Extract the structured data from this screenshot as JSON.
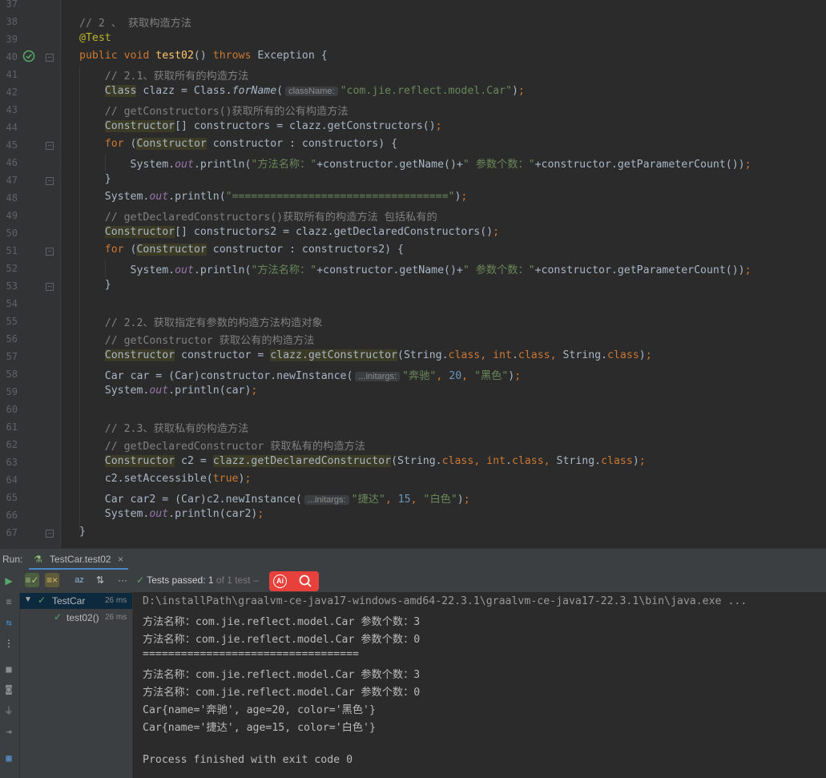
{
  "editor": {
    "lines": [
      {
        "n": "37",
        "html": ""
      },
      {
        "n": "38",
        "html": "<span class='cm'>// 2 、 获取构造方法</span>"
      },
      {
        "n": "39",
        "html": "<span class='an'>@Test</span>"
      },
      {
        "n": "40",
        "html": "<span class='kw'>public void </span><span class='fn'>test02</span>() <span class='kw'>throws </span>Exception {"
      },
      {
        "n": "41",
        "html": "    <span class='cm'>// 2.1、获取所有的构造方法</span>"
      },
      {
        "n": "42",
        "html": "    <span class='hl'>Class</span> clazz = Class.<span class='itf'>forName</span>(<span class='hint'>className:</span><span class='st'>\"com.jie.reflect.model.Car\"</span>)<span class='kw'>;</span>"
      },
      {
        "n": "43",
        "html": "    <span class='cm'>// getConstructors()获取所有的公有构造方法</span>"
      },
      {
        "n": "44",
        "html": "    <span class='hl'>Constructor</span>[] constructors = clazz.getConstructors()<span class='kw'>;</span>"
      },
      {
        "n": "45",
        "html": "    <span class='kw'>for </span>(<span class='hl'>Constructor</span> constructor : constructors) {"
      },
      {
        "n": "46",
        "html": "        System.<span class='it'>out</span>.println(<span class='st'>\"方法名称：\"</span>+constructor.getName()+<span class='st'>\" 参数个数：\"</span>+constructor.getParameterCount())<span class='kw'>;</span>"
      },
      {
        "n": "47",
        "html": "    }"
      },
      {
        "n": "48",
        "html": "    System.<span class='it'>out</span>.println(<span class='st'>\"==================================\"</span>)<span class='kw'>;</span>"
      },
      {
        "n": "49",
        "html": "    <span class='cm'>// getDeclaredConstructors()获取所有的构造方法 包括私有的</span>"
      },
      {
        "n": "50",
        "html": "    <span class='hl'>Constructor</span>[] constructors2 = clazz.getDeclaredConstructors()<span class='kw'>;</span>"
      },
      {
        "n": "51",
        "html": "    <span class='kw'>for </span>(<span class='hl'>Constructor</span> constructor : constructors2) {"
      },
      {
        "n": "52",
        "html": "        System.<span class='it'>out</span>.println(<span class='st'>\"方法名称：\"</span>+constructor.getName()+<span class='st'>\" 参数个数：\"</span>+constructor.getParameterCount())<span class='kw'>;</span>"
      },
      {
        "n": "53",
        "html": "    }"
      },
      {
        "n": "54",
        "html": ""
      },
      {
        "n": "55",
        "html": "    <span class='cm'>// 2.2、获取指定有参数的构造方法构造对象</span>"
      },
      {
        "n": "56",
        "html": "    <span class='cm'>// getConstructor 获取公有的构造方法</span>"
      },
      {
        "n": "57",
        "html": "    <span class='hl'>Constructor</span> constructor = <span class='hl'>clazz.getConstructor</span>(String.<span class='kw'>class, int</span>.<span class='kw'>class, </span>String.<span class='kw'>class</span>)<span class='kw'>;</span>"
      },
      {
        "n": "58",
        "html": "    Car car = (Car)constructor.newInstance(<span class='hint'>...initargs:</span><span class='st'>\"奔驰\"</span><span class='kw'>, </span><span class='nm'>20</span><span class='kw'>, </span><span class='st'>\"黑色\"</span>)<span class='kw'>;</span>"
      },
      {
        "n": "59",
        "html": "    System.<span class='it'>out</span>.println(car)<span class='kw'>;</span>"
      },
      {
        "n": "60",
        "html": ""
      },
      {
        "n": "61",
        "html": "    <span class='cm'>// 2.3、获取私有的构造方法</span>"
      },
      {
        "n": "62",
        "html": "    <span class='cm'>// getDeclaredConstructor 获取私有的构造方法</span>"
      },
      {
        "n": "63",
        "html": "    <span class='hl'>Constructor</span> c2 = <span class='hl'>clazz.getDeclaredConstructor</span>(String.<span class='kw'>class, int</span>.<span class='kw'>class, </span>String.<span class='kw'>class</span>)<span class='kw'>;</span>"
      },
      {
        "n": "64",
        "html": "    c2.setAccessible(<span class='kw'>true</span>)<span class='kw'>;</span>"
      },
      {
        "n": "65",
        "html": "    Car car2 = (Car)c2.newInstance(<span class='hint'>...initargs:</span><span class='st'>\"捷达\"</span><span class='kw'>, </span><span class='nm'>15</span><span class='kw'>, </span><span class='st'>\"白色\"</span>)<span class='kw'>;</span>"
      },
      {
        "n": "66",
        "html": "    System.<span class='it'>out</span>.println(car2)<span class='kw'>;</span>"
      },
      {
        "n": "67",
        "html": "}"
      }
    ]
  },
  "run": {
    "label": "Run:",
    "tab": "TestCar.test02",
    "tab_close": "×",
    "status": "Tests passed: 1",
    "status_suffix": "of 1 test –",
    "ai_label": "Ai",
    "more": "···"
  },
  "tree": {
    "items": [
      {
        "label": "TestCar",
        "time": "26 ms"
      },
      {
        "label": "test02()",
        "time": "26 ms"
      }
    ]
  },
  "console": {
    "lines": [
      "D:\\installPath\\graalvm-ce-java17-windows-amd64-22.3.1\\graalvm-ce-java17-22.3.1\\bin\\java.exe ...",
      "方法名称：com.jie.reflect.model.Car 参数个数：3",
      "方法名称：com.jie.reflect.model.Car 参数个数：0",
      "==================================",
      "方法名称：com.jie.reflect.model.Car 参数个数：3",
      "方法名称：com.jie.reflect.model.Car 参数个数：0",
      "Car{name='奔驰', age=20, color='黑色'}",
      "Car{name='捷达', age=15, color='白色'}",
      "",
      "Process finished with exit code 0"
    ]
  }
}
